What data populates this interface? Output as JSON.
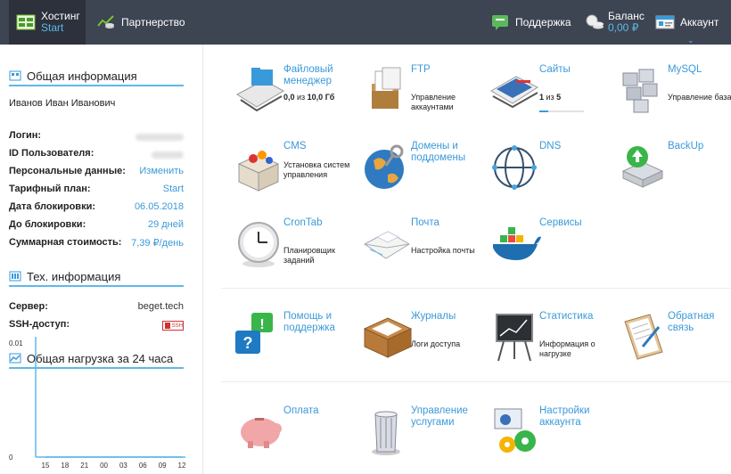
{
  "topbar": {
    "hosting_title": "Хостинг",
    "hosting_sub": "Start",
    "partner_title": "Партнерство",
    "support_title": "Поддержка",
    "balance_title": "Баланс",
    "balance_value": "0,00 ₽",
    "account_title": "Аккаунт"
  },
  "sidebar": {
    "general_title": "Общая информация",
    "owner": "Иванов Иван Иванович",
    "rows": [
      {
        "k": "Логин:",
        "v": ""
      },
      {
        "k": "ID Пользователя:",
        "v": ""
      },
      {
        "k": "Персональные данные:",
        "v": "Изменить"
      },
      {
        "k": "Тарифный план:",
        "v": "Start"
      },
      {
        "k": "Дата блокировки:",
        "v": "06.05.2018"
      },
      {
        "k": "До блокировки:",
        "v": "29 дней"
      },
      {
        "k": "Суммарная стоимость:",
        "v": "7,39 ₽/день"
      }
    ],
    "tech_title": "Тех. информация",
    "server_label": "Сервер:",
    "server_value": "beget.tech",
    "ssh_label": "SSH-доступ:",
    "ssh_badge": "SSH",
    "load_title": "Общая нагрузка за 24 часа"
  },
  "chart_data": {
    "type": "line",
    "title": "Общая нагрузка за 24 часа",
    "x": [
      "15",
      "18",
      "21",
      "00",
      "03",
      "06",
      "09",
      "12"
    ],
    "y_ticks": [
      "0.01",
      "0"
    ],
    "ylim": [
      0,
      0.01
    ],
    "series": [
      {
        "values": [
          0,
          0,
          0,
          0,
          0,
          0,
          0,
          0
        ]
      }
    ],
    "accent": "#5fb8e8"
  },
  "tiles": {
    "files": {
      "title": "Файловый менеджер",
      "desc_used": "0,0",
      "desc_of": " из ",
      "desc_total": "10,0 Гб"
    },
    "ftp": {
      "title": "FTP",
      "desc": "Управление аккаунтами"
    },
    "sites": {
      "title": "Сайты",
      "desc_used": "1",
      "desc_of": " из ",
      "desc_total": "5",
      "progress": 0.2
    },
    "mysql": {
      "title": "MySQL",
      "desc": "Управление базами"
    },
    "cms": {
      "title": "CMS",
      "desc": "Установка систем управления"
    },
    "domains": {
      "title": "Домены и поддомены"
    },
    "dns": {
      "title": "DNS"
    },
    "backup": {
      "title": "BackUp"
    },
    "crontab": {
      "title": "CronTab",
      "desc": "Планировщик заданий"
    },
    "mail": {
      "title": "Почта",
      "desc": "Настройка почты"
    },
    "services": {
      "title": "Сервисы"
    },
    "help": {
      "title": "Помощь и поддержка"
    },
    "logs": {
      "title": "Журналы",
      "desc": "Логи доступа"
    },
    "stats": {
      "title": "Статистика",
      "desc": "Информация о нагрузке"
    },
    "feedback": {
      "title": "Обратная связь"
    },
    "payment": {
      "title": "Оплата"
    },
    "manage": {
      "title": "Управление услугами"
    },
    "settings": {
      "title": "Настройки аккаунта"
    }
  },
  "colors": {
    "accent": "#5fb8e8",
    "topbar": "#3d4452",
    "link": "#3a9ad9"
  }
}
